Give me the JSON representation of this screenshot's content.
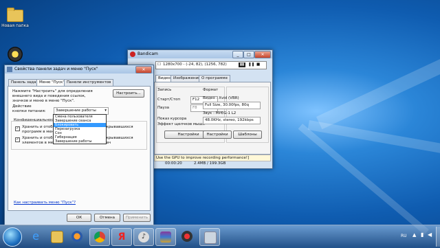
{
  "desktop": {
    "icons": [
      {
        "label": "Новая папка",
        "icon": "folder-icon"
      },
      {
        "label": "",
        "icon": "bandicam-icon"
      }
    ]
  },
  "properties_window": {
    "title": "Свойства панели задач и меню \"Пуск\"",
    "tabs": [
      "Панель задач",
      "Меню \"Пуск\"",
      "Панели инструментов"
    ],
    "active_tab": "Меню \"Пуск\"",
    "customize_text": "Нажмите \"Настроить\" для определения внешнего вида и поведения ссылок, значков и меню в меню \"Пуск\".",
    "customize_button": "Настроить...",
    "power_label": "Действие кнопки питания:",
    "power_value": "Завершение работы",
    "privacy_label": "Конфиденциальность",
    "check1": "Хранить и отображать список недавно открывавшихся программ в меню \"Пуск\"",
    "check2": "Хранить и отображать список недавно открывавшихся элементов в меню \"Пуск\" и на панели задач",
    "dropdown_options": [
      "Смена пользователя",
      "Завершение сеанса",
      "Блокировать",
      "Перезагрузка",
      "Сон",
      "Гибернация",
      "Завершение работы"
    ],
    "dropdown_selected": "Блокировать",
    "help_link": "Как настраивать меню \"Пуск\"?",
    "ok": "ОК",
    "cancel": "Отмена",
    "apply": "Применить"
  },
  "bandicam": {
    "title": "Bandicam",
    "resolution": "1280x700 - (-24, 82), (1256, 782)",
    "tabs": [
      "Видео",
      "Изображение",
      "О программе"
    ],
    "record_group": "Запись",
    "hotkey_label": "Старт/Стоп",
    "hotkey_value": "F12",
    "pause_label": "Пауза",
    "pause_value": "F8",
    "cursor_label": "Показ курсора",
    "click_label": "Эффект щелчков мыши",
    "settings_left": "Настройки",
    "format_group": "Формат",
    "video_codec": "Видео : Xvid (VBR)",
    "video_info": "Full Size, 30.00fps, 80q",
    "audio_codec": "Звук : MPEG-1 L2",
    "audio_info": "48.0KHz, stereo, 192kbps",
    "settings_right": "Настройки",
    "templates": "Шаблоны",
    "gpu_tip": "Use the GPU to improve recording performance!]",
    "time": "00:00:20",
    "size": "2.4MB / 199.3GB"
  },
  "taskbar": {
    "language": "RU",
    "items": [
      "ie-icon",
      "explorer-icon",
      "media-player-icon",
      "chrome-icon",
      "yandex-icon",
      "audio-icon",
      "winrar-icon",
      "paint-icon",
      "bandicam-icon",
      "control-panel-icon"
    ]
  },
  "colors": {
    "selection": "#3399ff",
    "link": "#0033cc",
    "desktop": "#1f6fc4"
  }
}
